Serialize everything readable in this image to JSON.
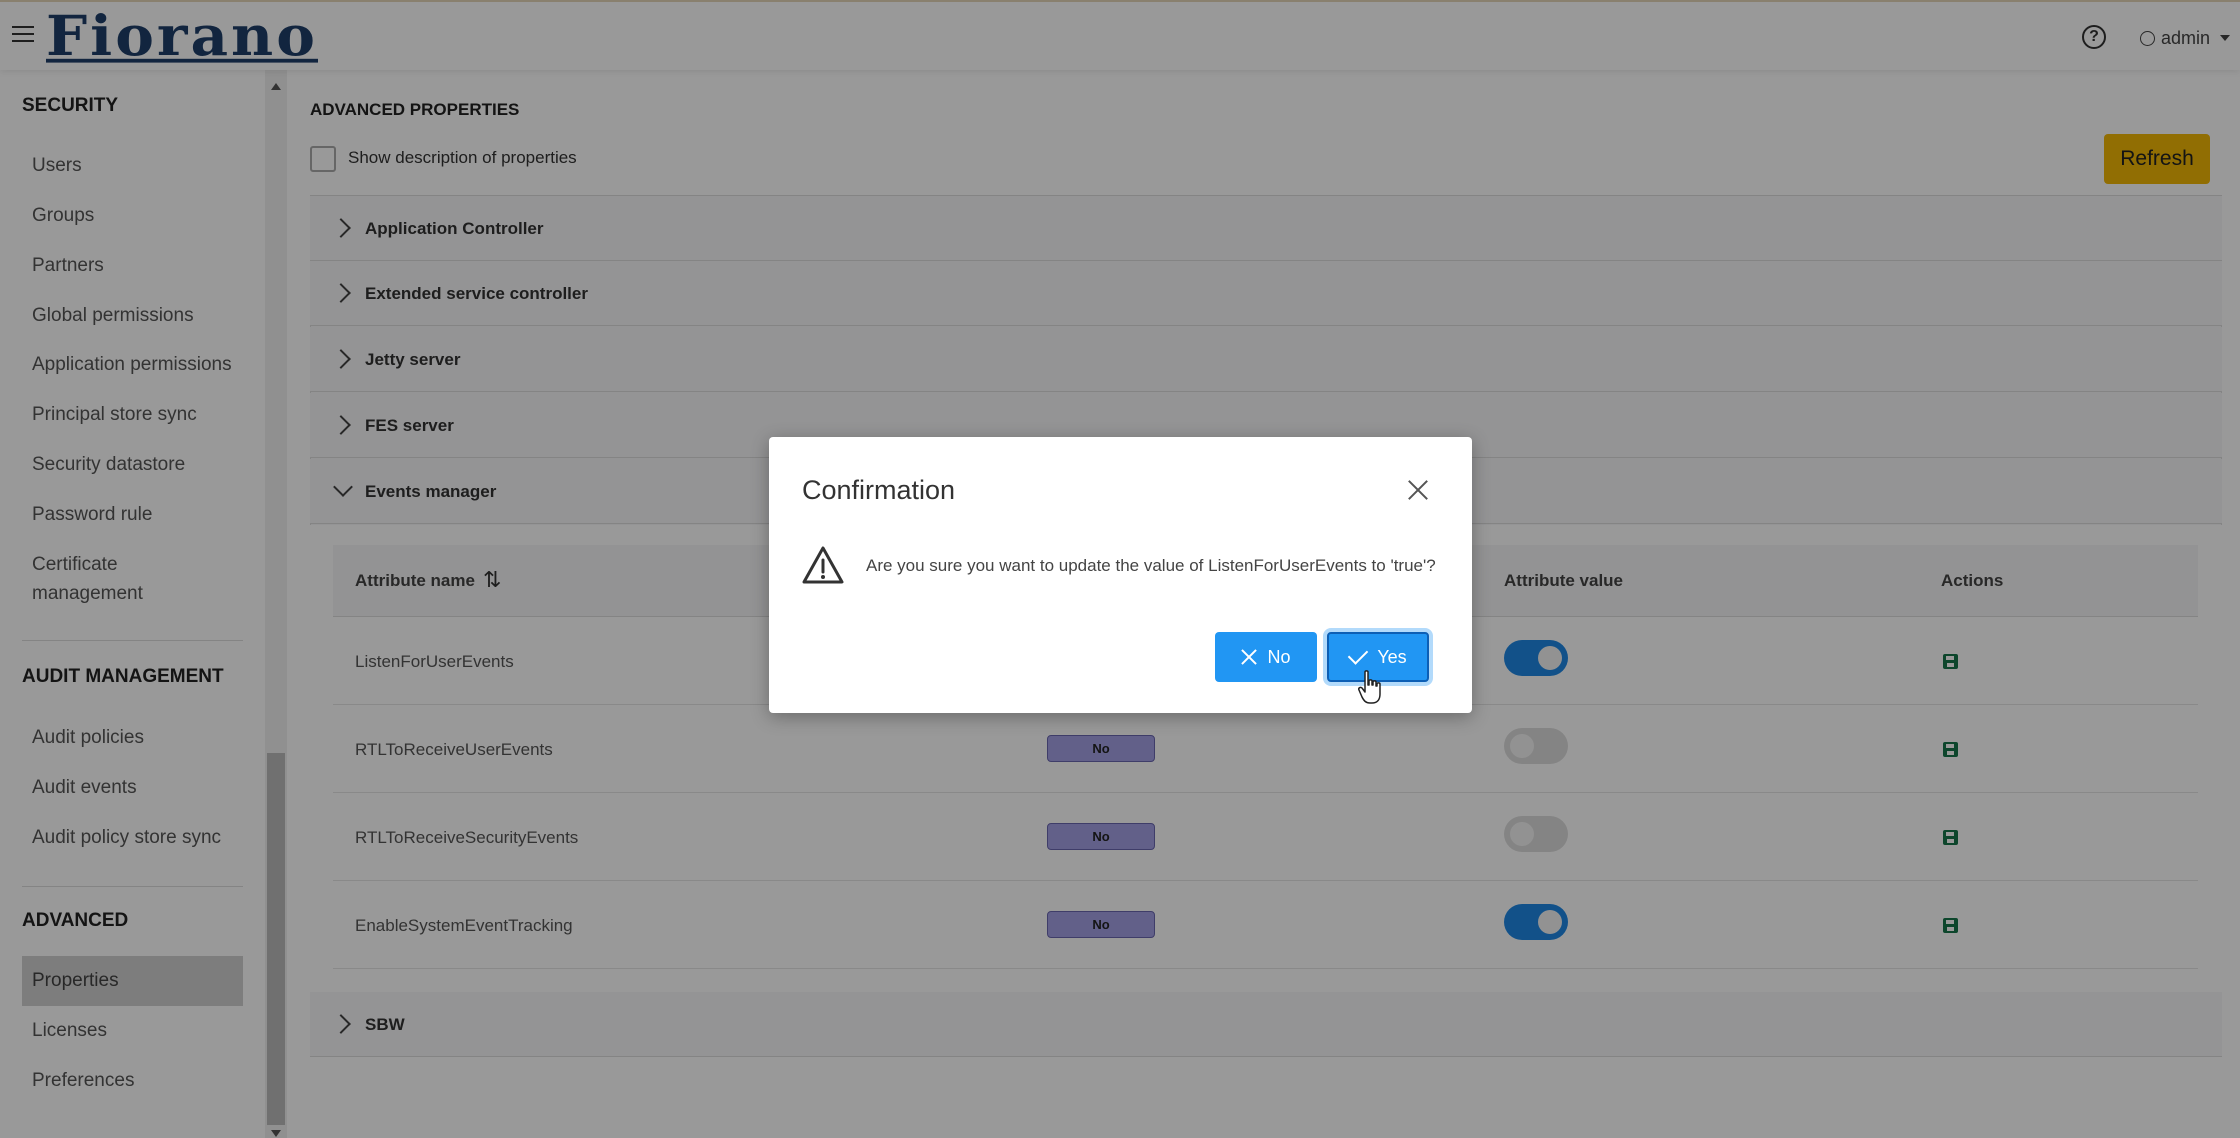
{
  "header": {
    "logo_text": "Fiorano",
    "help_symbol": "?",
    "user_label": "admin"
  },
  "sidebar": {
    "security_title": "SECURITY",
    "security_items": [
      {
        "label": "Users"
      },
      {
        "label": "Groups"
      },
      {
        "label": "Partners"
      },
      {
        "label": "Global permissions"
      },
      {
        "label": "Application permissions"
      },
      {
        "label": "Principal store sync"
      },
      {
        "label": "Security datastore"
      },
      {
        "label": "Password rule"
      },
      {
        "label": "Certificate management"
      }
    ],
    "audit_title": "AUDIT MANAGEMENT",
    "audit_items": [
      {
        "label": "Audit policies"
      },
      {
        "label": "Audit events"
      },
      {
        "label": "Audit policy store sync"
      }
    ],
    "advanced_title": "ADVANCED",
    "advanced_items": [
      {
        "label": "Properties",
        "active": true
      },
      {
        "label": "Licenses"
      },
      {
        "label": "Preferences"
      }
    ]
  },
  "main": {
    "title": "ADVANCED PROPERTIES",
    "show_description_label": "Show description of properties",
    "refresh_label": "Refresh",
    "sections": [
      {
        "label": "Application Controller",
        "expanded": false
      },
      {
        "label": "Extended service controller",
        "expanded": false
      },
      {
        "label": "Jetty server",
        "expanded": false
      },
      {
        "label": "FES server",
        "expanded": false
      },
      {
        "label": "Events manager",
        "expanded": true
      },
      {
        "label": "SBW",
        "expanded": false
      }
    ],
    "table": {
      "col_attribute_name": "Attribute name",
      "col_attribute_value": "Attribute value",
      "col_actions": "Actions",
      "rows": [
        {
          "name": "ListenForUserEvents",
          "badge": "",
          "toggle": true
        },
        {
          "name": "RTLToReceiveUserEvents",
          "badge": "No",
          "toggle": false
        },
        {
          "name": "RTLToReceiveSecurityEvents",
          "badge": "No",
          "toggle": false
        },
        {
          "name": "EnableSystemEventTracking",
          "badge": "No",
          "toggle": true
        }
      ]
    }
  },
  "dialog": {
    "title": "Confirmation",
    "message": "Are you sure you want to update the value of ListenForUserEvents to 'true'?",
    "no_label": "No",
    "yes_label": "Yes"
  },
  "colors": {
    "primary": "#2196f3",
    "refresh": "#f2b705",
    "badge": "#a3a0e4",
    "save": "#17754a",
    "logo": "#1e3f6a"
  }
}
